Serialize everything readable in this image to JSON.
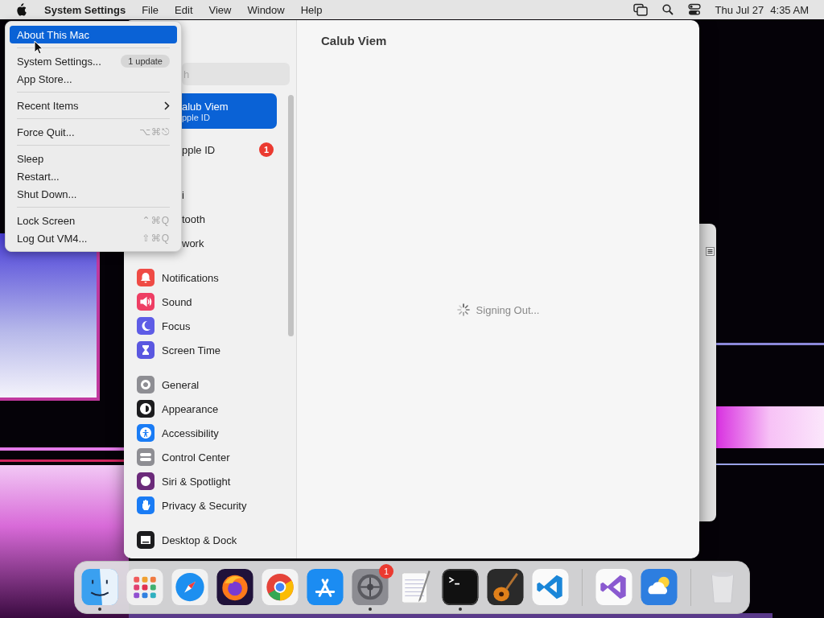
{
  "menu_bar": {
    "app_name": "System Settings",
    "menus": [
      "File",
      "Edit",
      "View",
      "Window",
      "Help"
    ],
    "date": "Thu Jul 27",
    "time": "4:35 AM"
  },
  "apple_menu": {
    "groups": [
      [
        {
          "kind": "item",
          "label": "About This Mac",
          "selected": true
        }
      ],
      [
        {
          "kind": "item",
          "label": "System Settings...",
          "badge": "1 update",
          "selected": false
        },
        {
          "kind": "item",
          "label": "App Store...",
          "selected": false
        }
      ],
      [
        {
          "kind": "submenu",
          "label": "Recent Items",
          "selected": false
        }
      ],
      [
        {
          "kind": "item",
          "label": "Force Quit...",
          "shortcut": "⌥⌘⎋",
          "selected": false
        }
      ],
      [
        {
          "kind": "item",
          "label": "Sleep",
          "selected": false
        },
        {
          "kind": "item",
          "label": "Restart...",
          "selected": false
        },
        {
          "kind": "item",
          "label": "Shut Down...",
          "selected": false
        }
      ],
      [
        {
          "kind": "item",
          "label": "Lock Screen",
          "shortcut": "⌃⌘Q",
          "selected": false
        },
        {
          "kind": "item",
          "label": "Log Out VM4...",
          "shortcut": "⇧⌘Q",
          "selected": false
        }
      ]
    ]
  },
  "settings_window": {
    "title": "Calub Viem",
    "status": "Signing Out...",
    "sidebar": {
      "search": {
        "placeholder": "h"
      },
      "covered_items": [
        {
          "kind": "account",
          "label": "alub Viem",
          "subtitle": "pple ID",
          "selected": true
        },
        {
          "kind": "row",
          "label": "pple ID",
          "badge": "1",
          "selected": false
        },
        {
          "kind": "row",
          "label": "i",
          "selected": false
        },
        {
          "kind": "row",
          "label": "tooth",
          "selected": false
        },
        {
          "kind": "row",
          "label": "work",
          "selected": false
        }
      ],
      "groups": [
        [
          {
            "kind": "bell",
            "label": "Notifications",
            "color": "#ef4b45",
            "selected": false
          },
          {
            "kind": "speaker",
            "label": "Sound",
            "color": "#ee3e64",
            "selected": false
          },
          {
            "kind": "moon",
            "label": "Focus",
            "color": "#5e5ce6",
            "selected": false
          },
          {
            "kind": "hourglass",
            "label": "Screen Time",
            "color": "#5a57e0",
            "selected": false
          }
        ],
        [
          {
            "kind": "gear",
            "label": "General",
            "color": "#8e8e93",
            "selected": false
          },
          {
            "kind": "contrast",
            "label": "Appearance",
            "color": "#1c1c1e",
            "selected": false
          },
          {
            "kind": "person",
            "label": "Accessibility",
            "color": "#1a7cf5",
            "selected": false
          },
          {
            "kind": "toggles",
            "label": "Control Center",
            "color": "#8e8e93",
            "selected": false
          },
          {
            "kind": "orb",
            "label": "Siri & Spotlight",
            "color": "#6b2a7a",
            "selected": false
          },
          {
            "kind": "hand",
            "label": "Privacy & Security",
            "color": "#1a7cf5",
            "selected": false
          }
        ],
        [
          {
            "kind": "dock",
            "label": "Desktop & Dock",
            "color": "#1c1c1e",
            "selected": false
          }
        ]
      ]
    }
  },
  "dock": {
    "groups": [
      [
        {
          "kind": "finder",
          "running": true
        },
        {
          "kind": "launchpad",
          "running": false
        },
        {
          "kind": "safari",
          "running": false
        },
        {
          "kind": "firefox",
          "running": false
        },
        {
          "kind": "chrome",
          "running": false
        },
        {
          "kind": "appstore",
          "running": false
        },
        {
          "kind": "settings",
          "running": true,
          "badge": "1"
        },
        {
          "kind": "textedit",
          "running": false
        },
        {
          "kind": "terminal",
          "running": true
        },
        {
          "kind": "garageband",
          "running": false
        },
        {
          "kind": "vscode",
          "running": false
        }
      ],
      [
        {
          "kind": "visualstudio",
          "running": false
        },
        {
          "kind": "weather",
          "running": false
        }
      ],
      [
        {
          "kind": "trash",
          "running": false
        }
      ]
    ]
  }
}
